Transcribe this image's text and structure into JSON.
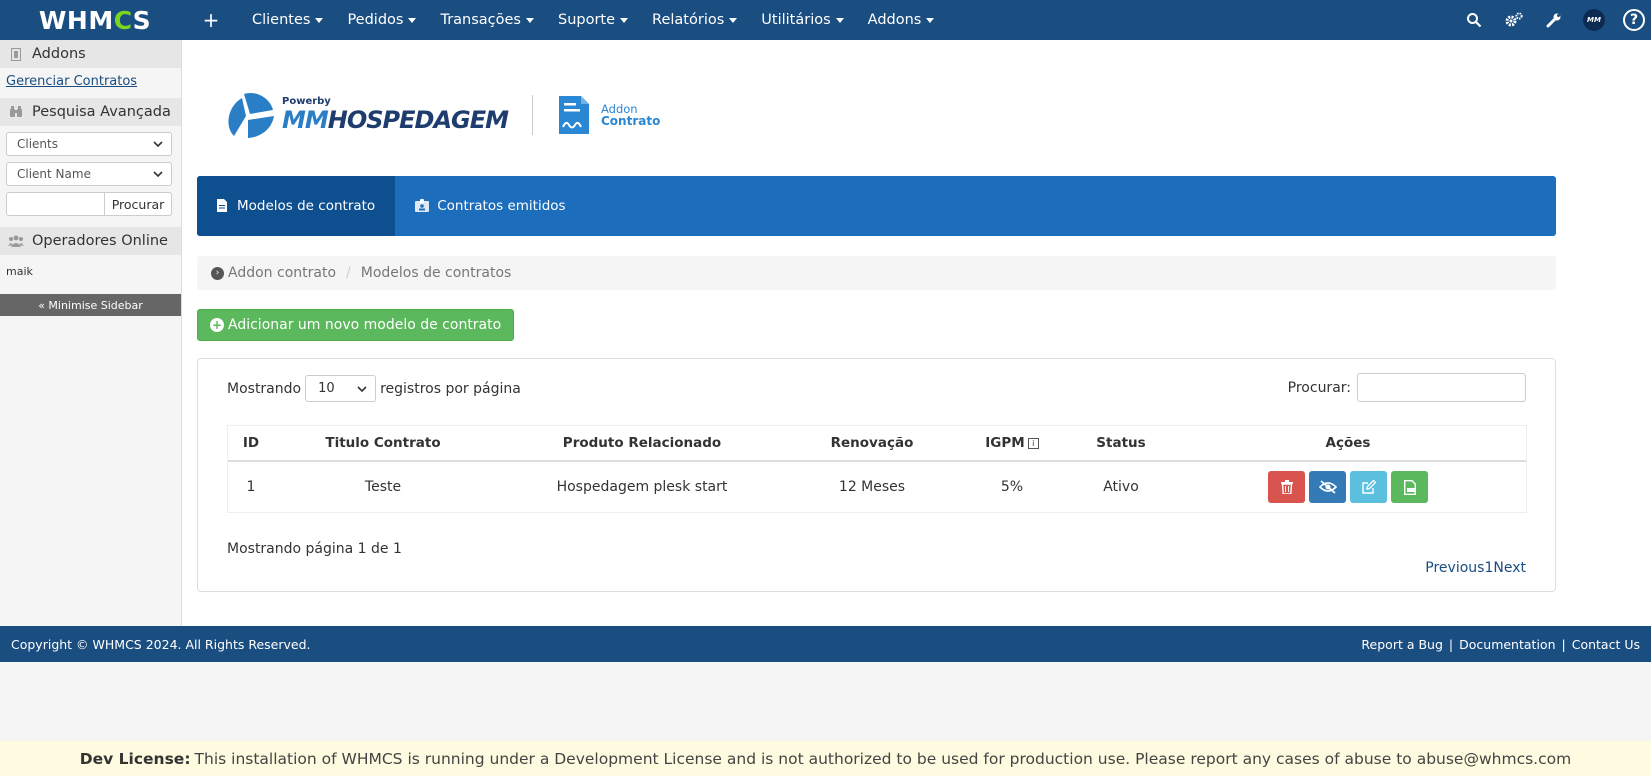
{
  "topbar": {
    "logo": "WHMCS",
    "plus": "+",
    "nav": [
      {
        "label": "Clientes"
      },
      {
        "label": "Pedidos"
      },
      {
        "label": "Transações"
      },
      {
        "label": "Suporte"
      },
      {
        "label": "Relatórios"
      },
      {
        "label": "Utilitários"
      },
      {
        "label": "Addons"
      }
    ],
    "avatar_text": "MM",
    "help": "?"
  },
  "sidebar": {
    "addons_title": "Addons",
    "manage_link": "Gerenciar Contratos",
    "search_title": "Pesquisa Avançada",
    "type_select": "Clients",
    "field_select": "Client Name",
    "search_btn": "Procurar",
    "online_title": "Operadores Online",
    "operator": "maik",
    "minimise": "« Minimise Sidebar"
  },
  "brand": {
    "powerby": "Powerby",
    "name_mm": "MM",
    "name_rest": "HOSPEDAGEM",
    "addon_line1": "Addon",
    "addon_line2": "Contrato"
  },
  "tabs": [
    {
      "label": "Modelos de contrato",
      "active": true
    },
    {
      "label": "Contratos emitidos",
      "active": false
    }
  ],
  "breadcrumb": {
    "root": "Addon contrato",
    "current": "Modelos de contratos"
  },
  "add_button": "Adicionar um novo modelo de contrato",
  "table_controls": {
    "show_prefix": "Mostrando",
    "page_length": "10",
    "show_suffix": "registros por página",
    "search_label": "Procurar:"
  },
  "table": {
    "headers": {
      "id": "ID",
      "title": "Titulo Contrato",
      "product": "Produto Relacionado",
      "renewal": "Renovação",
      "igpm": "IGPM",
      "status": "Status",
      "actions": "Ações"
    },
    "rows": [
      {
        "id": "1",
        "title": "Teste",
        "product": "Hospedagem plesk start",
        "renewal": "12 Meses",
        "igpm": "5%",
        "status": "Ativo"
      }
    ]
  },
  "table_info": "Mostrando página 1 de 1",
  "pager": {
    "prev": "Previous",
    "page": "1",
    "next": "Next"
  },
  "footer": {
    "copyright": "Copyright © WHMCS 2024. All Rights Reserved.",
    "report_bug": "Report a Bug",
    "documentation": "Documentation",
    "contact": "Contact Us",
    "sep": "|"
  },
  "dev_license": {
    "label": "Dev License:",
    "text": "This installation of WHMCS is running under a Development License and is not authorized to be used for production use. Please report any cases of abuse to abuse@whmcs.com"
  },
  "colors": {
    "navbar": "#1a4d80",
    "tabs": "#1c6ebc",
    "tab_active": "#0e4f8f",
    "add_green": "#5cb85c",
    "delete_red": "#d9534f",
    "view_blue": "#337ab7",
    "edit_cyan": "#5bc0de",
    "pdf_green": "#5cb85c"
  }
}
